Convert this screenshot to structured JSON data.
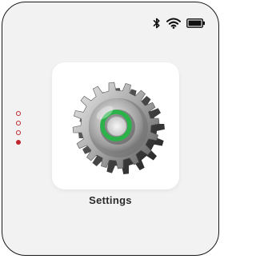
{
  "status": {
    "icons": [
      "bluetooth-icon",
      "wifi-icon",
      "battery-icon"
    ],
    "battery_level": 1.0
  },
  "page_indicator": {
    "total": 4,
    "active_index": 3,
    "color": "#c0262d"
  },
  "app": {
    "name": "Settings",
    "icon": "gear-icon",
    "accent_color": "#2bb34a"
  }
}
